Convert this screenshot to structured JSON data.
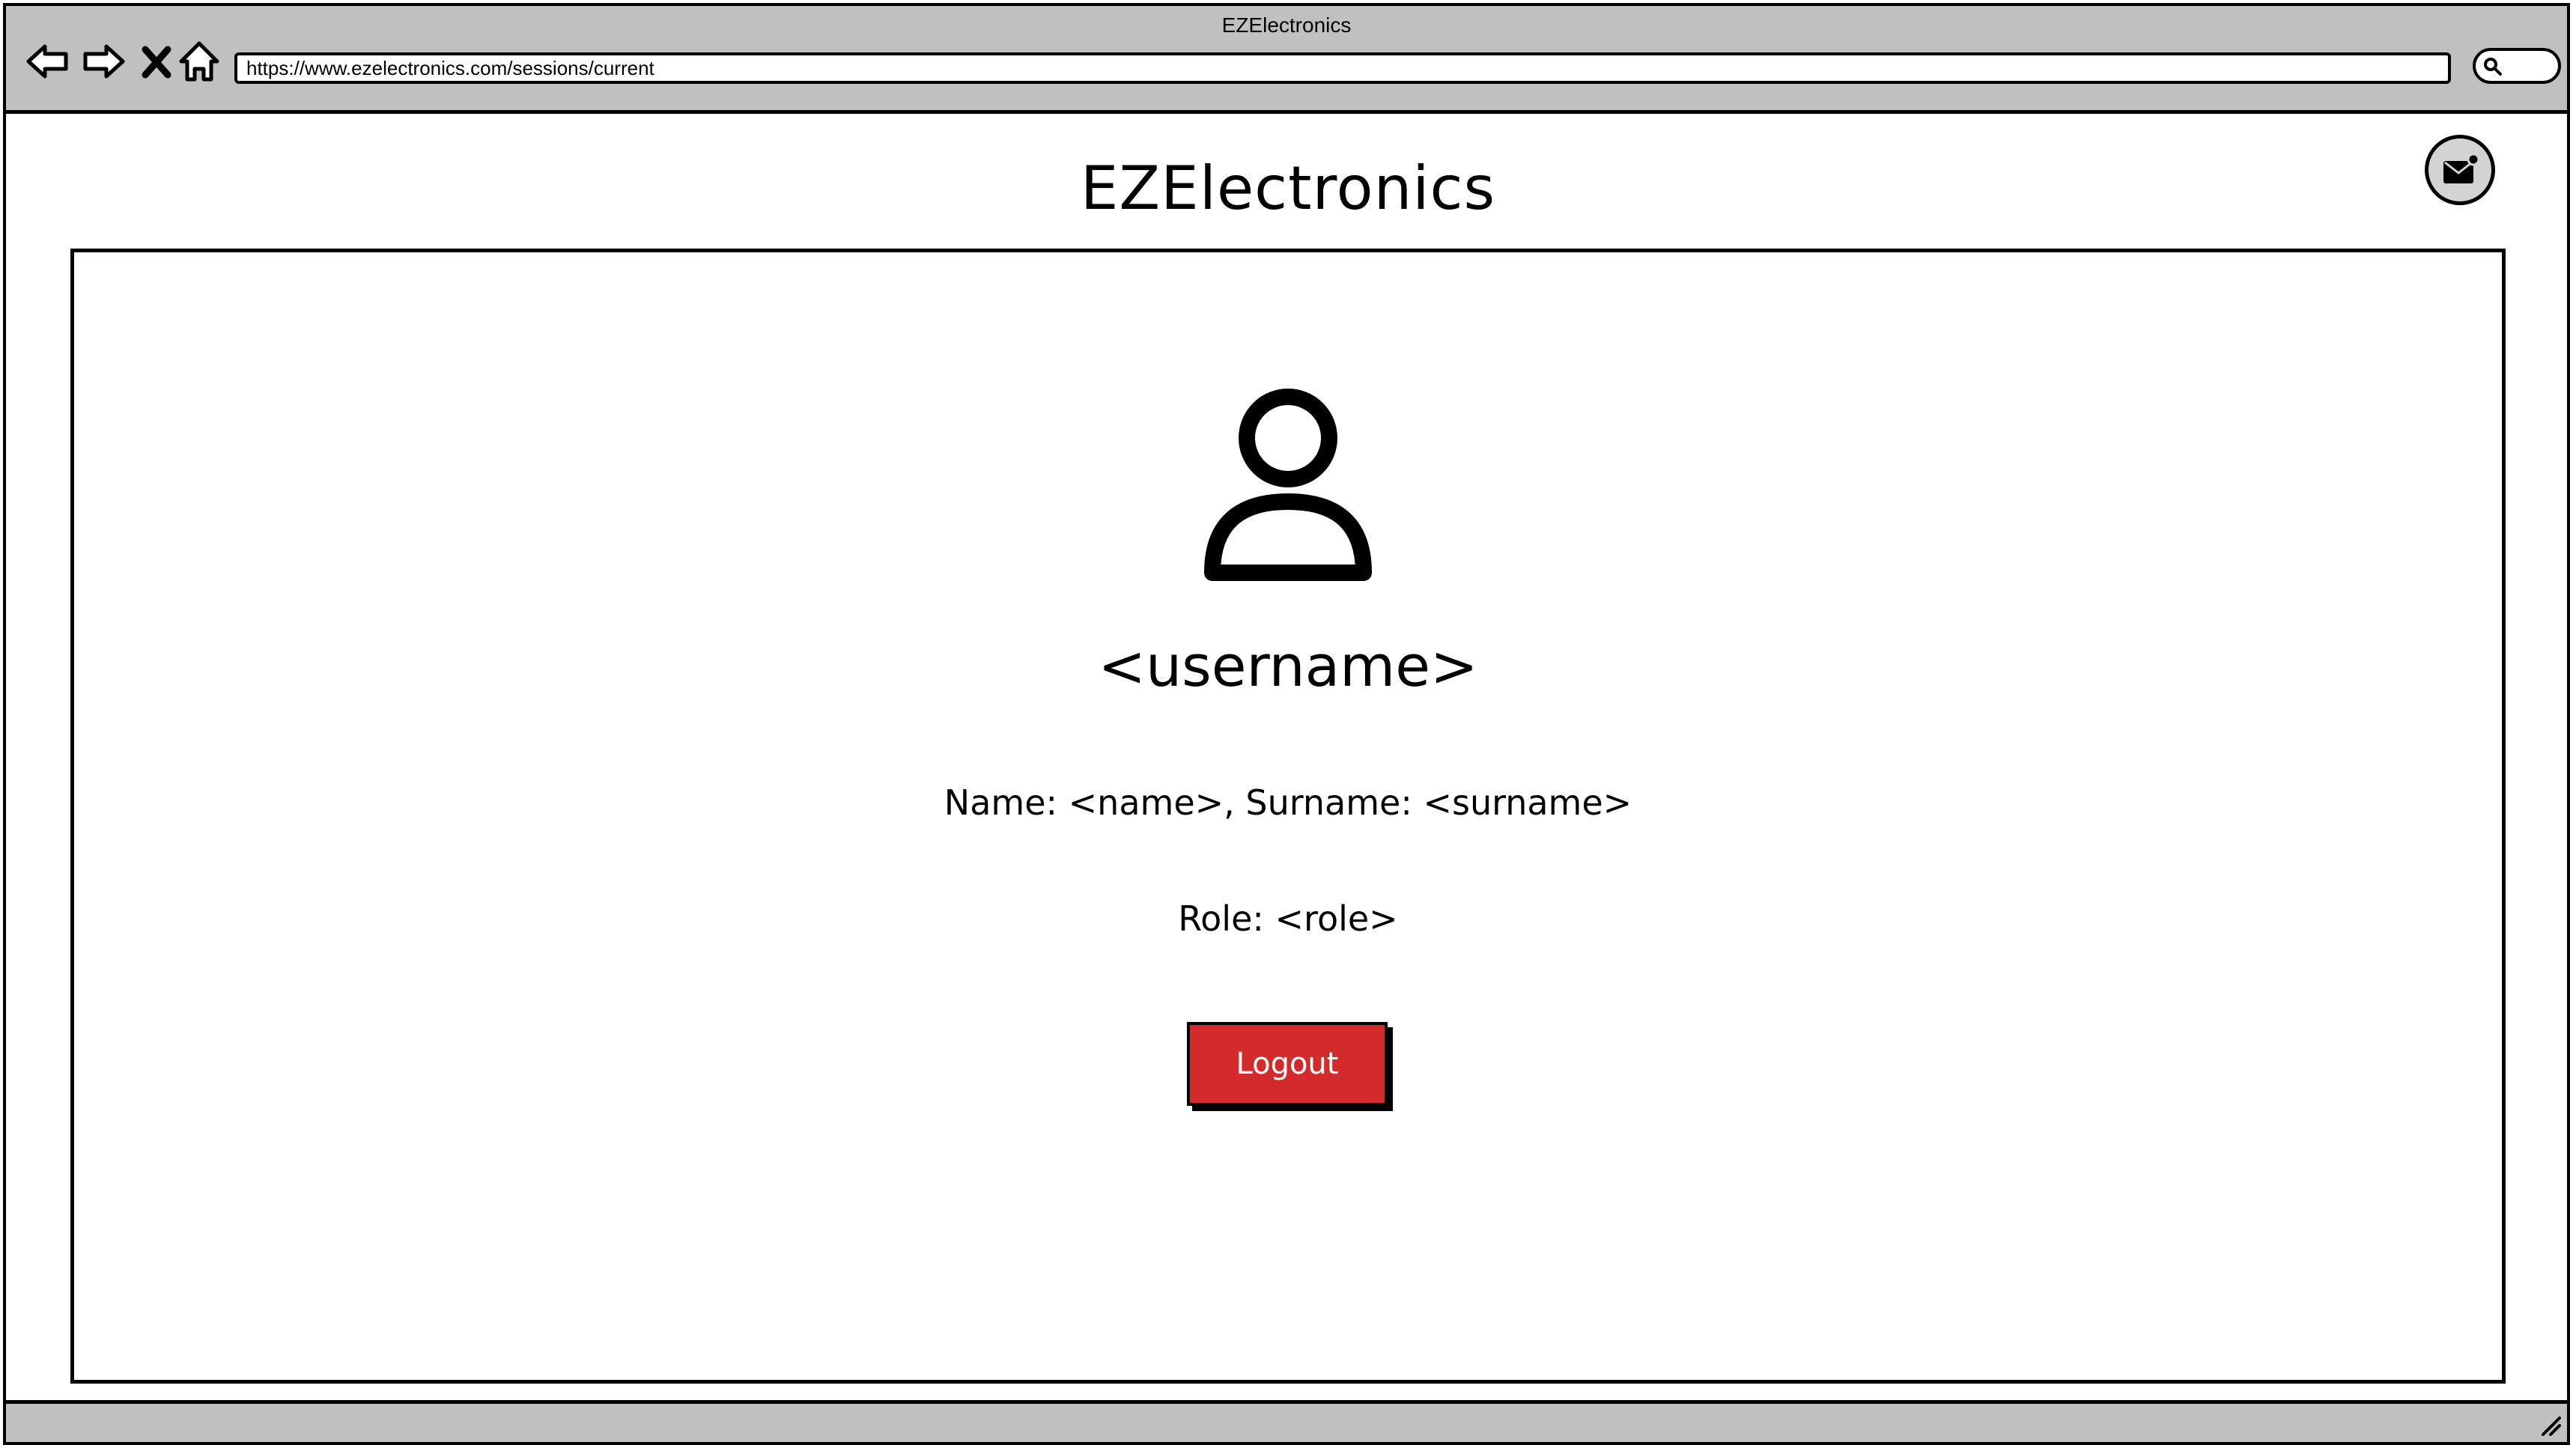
{
  "browser": {
    "window_title": "EZElectronics",
    "url": "https://www.ezelectronics.com/sessions/current",
    "nav_icons": [
      "back-arrow-icon",
      "forward-arrow-icon",
      "stop-icon",
      "home-icon"
    ]
  },
  "header": {
    "app_title": "EZElectronics",
    "mail_icon": "mail-icon"
  },
  "profile": {
    "avatar_icon": "user-icon",
    "username": "<username>",
    "name_line": "Name: <name>, Surname: <surname>",
    "role_line": "Role: <role>",
    "logout_label": "Logout"
  },
  "colors": {
    "chrome_gray": "#c0c0c0",
    "logout_red": "#d32b2b",
    "mail_button_bg": "#d3d3d3"
  }
}
